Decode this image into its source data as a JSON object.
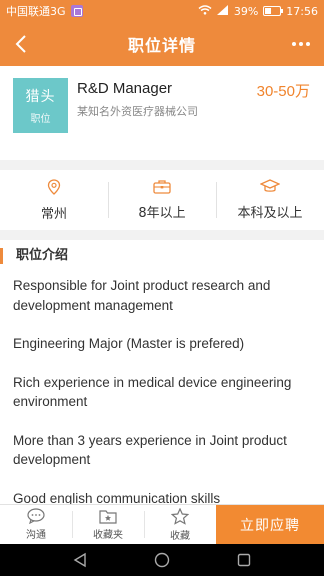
{
  "status_bar": {
    "carrier": "中国联通3G",
    "battery": "39%",
    "time": "17:56"
  },
  "nav": {
    "title": "职位详情"
  },
  "job": {
    "logo_main": "猎头",
    "logo_sub": "职位",
    "title": "R&D Manager",
    "salary": "30-50万",
    "company": "某知名外资医疗器械公司"
  },
  "info": {
    "location": "常州",
    "experience": "8年以上",
    "education": "本科及以上"
  },
  "description": {
    "heading": "职位介绍",
    "lines": [
      "Responsible for Joint product research and development management",
      "Engineering Major (Master is prefered)",
      "Rich experience in medical device engineering environment",
      "More than 3 years experience in Joint product development",
      "Good english communication skills"
    ]
  },
  "bottom_bar": {
    "chat": "沟通",
    "folder": "收藏夹",
    "favorite": "收藏",
    "apply": "立即应聘"
  },
  "colors": {
    "accent": "#ee8a3c",
    "salary": "#f0842d",
    "logo_bg": "#6cc8c9"
  }
}
